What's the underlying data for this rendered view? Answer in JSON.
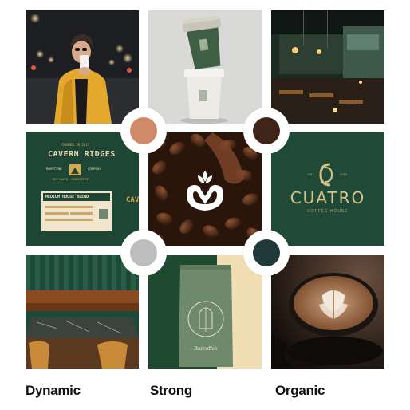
{
  "labels": {
    "dynamic": "Dynamic",
    "strong": "Strong",
    "organic": "Organic"
  },
  "swatches": [
    {
      "color": "#cf8a69"
    },
    {
      "color": "#3f2418"
    },
    {
      "color": "#bdbdbd"
    },
    {
      "color": "#22393a"
    }
  ],
  "tile_cavern": {
    "founded": "FOUNDED IN 2011",
    "title": "CAVERN RIDGES",
    "left_tag": "ROASTING",
    "right_tag": "COMPANY",
    "location": "NEW HAVEN, CONNECTICUT",
    "blend": "MEDIUM HOUSE BLEND",
    "side_text": "CAVERN RIDGE"
  },
  "tile_cuatro": {
    "est": "EST",
    "year": "2019",
    "title": "CUATRO",
    "subtitle": "COFFEE HOUSE"
  },
  "tile_bag": {
    "brand": "Barcoffee"
  },
  "colors": {
    "deep_green": "#1e4634",
    "cuatro_green": "#1f4a37",
    "gold": "#d8c28a"
  }
}
